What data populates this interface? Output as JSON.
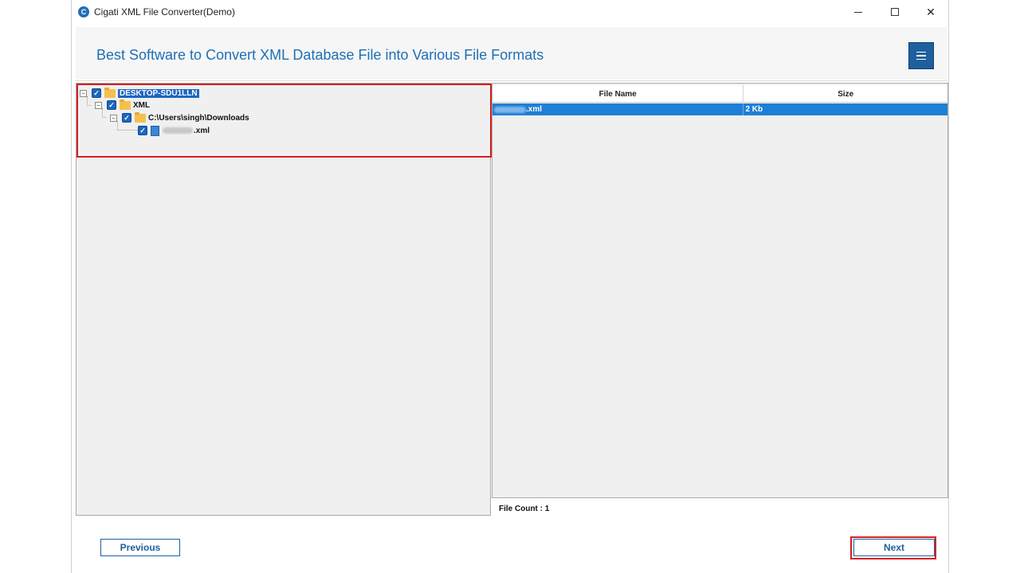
{
  "window": {
    "title": "Cigati XML File Converter(Demo)",
    "logo_letter": "C"
  },
  "window_controls": {
    "close_glyph": "✕"
  },
  "header": {
    "title": "Best Software to Convert XML Database File into Various File Formats"
  },
  "tree": {
    "root": {
      "label": "DESKTOP-SDU1LLN",
      "checked": true,
      "expander": "−"
    },
    "xml": {
      "label": "XML",
      "checked": true,
      "expander": "−"
    },
    "folder": {
      "label": "C:\\Users\\singh\\Downloads",
      "checked": true,
      "expander": "−"
    },
    "file": {
      "label_suffix": ".xml",
      "checked": true
    }
  },
  "grid": {
    "columns": [
      "File Name",
      "Size"
    ],
    "rows": [
      {
        "name_suffix": ".xml",
        "size": "2 Kb"
      }
    ]
  },
  "status": {
    "file_count": "File Count : 1"
  },
  "buttons": {
    "previous": "Previous",
    "next": "Next"
  },
  "colors": {
    "accent": "#1f6fb5",
    "selection": "#1e7fd6",
    "highlight": "#d42020"
  },
  "icons": {
    "check": "✓"
  }
}
